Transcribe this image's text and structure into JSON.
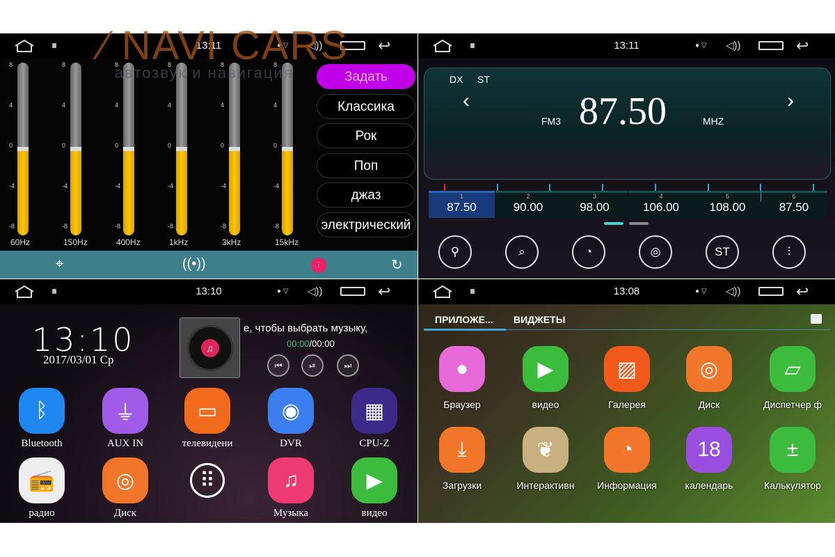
{
  "watermark": {
    "brand": "NAVI CARS",
    "tagline": "автозвук и навигация"
  },
  "equalizer": {
    "status_time": "13:11",
    "scale": [
      "8",
      "4",
      "0",
      "-4",
      "-8"
    ],
    "bands": [
      {
        "label": "60Hz",
        "value": 0
      },
      {
        "label": "150Hz",
        "value": 0
      },
      {
        "label": "400Hz",
        "value": 0
      },
      {
        "label": "1kHz",
        "value": 0
      },
      {
        "label": "3kHz",
        "value": 0
      },
      {
        "label": "15kHz",
        "value": 0
      }
    ],
    "range": [
      -8,
      8
    ],
    "presets": [
      "Задать",
      "Классика",
      "Рок",
      "Поп",
      "джаз",
      "электрический"
    ],
    "active_preset": "Задать",
    "bottom_icons": [
      "crosshair-icon",
      "surround-icon",
      "equalizer-icon",
      "reset-icon"
    ],
    "colors": {
      "fill": "#ffc400",
      "active": "#c000e8",
      "bar": "#3d7f8a"
    }
  },
  "radio": {
    "status_time": "13:11",
    "dx": "DX",
    "st": "ST",
    "band": "FM3",
    "frequency": "87.50",
    "unit": "MHZ",
    "presets": [
      {
        "n": "1",
        "f": "87.50"
      },
      {
        "n": "2",
        "f": "90.00"
      },
      {
        "n": "3",
        "f": "98.00"
      },
      {
        "n": "4",
        "f": "106.00"
      },
      {
        "n": "5",
        "f": "108.00"
      },
      {
        "n": "6",
        "f": "87.50"
      }
    ],
    "selected_preset": 1,
    "page": 1,
    "pages": 2,
    "buttons": [
      {
        "icon": "search-icon",
        "label": ""
      },
      {
        "icon": "scan-save-icon",
        "label": ""
      },
      {
        "icon": "signal-icon",
        "label": ""
      },
      {
        "icon": "local-distance-icon",
        "label": ""
      },
      {
        "icon": "stereo-icon",
        "label": "ST"
      },
      {
        "icon": "equalizer-icon",
        "label": ""
      }
    ]
  },
  "home": {
    "status_time": "13:10",
    "clock": "13:10",
    "date": "2017/03/01 Ср",
    "music_hint": "е, чтобы выбрать музыку,",
    "elapsed": "00:00",
    "total": "/00:00",
    "apps": [
      {
        "label": "Bluetooth",
        "icon": "bluetooth-icon",
        "color": "#1e88f0"
      },
      {
        "label": "AUX IN",
        "icon": "aux-icon",
        "color": "#a05be8"
      },
      {
        "label": "телевидени",
        "icon": "tv-icon",
        "color": "#f26a1b"
      },
      {
        "label": "DVR",
        "icon": "webcam-icon",
        "color": "#3a7ef0"
      },
      {
        "label": "CPU-Z",
        "icon": "cpu-icon",
        "color": "#3b2a8a"
      },
      {
        "label": "радио",
        "icon": "radio-icon",
        "color": "#eeeeee"
      },
      {
        "label": "Диск",
        "icon": "disc-icon",
        "color": "#f2762a"
      },
      {
        "label": "",
        "icon": "all-apps-icon",
        "color": "transparent"
      },
      {
        "label": "Музыка",
        "icon": "music-icon",
        "color": "#ee3b73"
      },
      {
        "label": "видео",
        "icon": "video-icon",
        "color": "#3cbc3c"
      }
    ]
  },
  "drawer": {
    "status_time": "13:08",
    "tabs": [
      "ПРИЛОЖЕ...",
      "ВИДЖЕТЫ"
    ],
    "apps": [
      {
        "label": "Браузер",
        "icon": "globe-icon",
        "color": "#e86ad8"
      },
      {
        "label": "видео",
        "icon": "video-icon",
        "color": "#3cbc3c"
      },
      {
        "label": "Галерея",
        "icon": "gallery-icon",
        "color": "#f25a1b"
      },
      {
        "label": "Диск",
        "icon": "disc-icon",
        "color": "#f2762a"
      },
      {
        "label": "Диспетчер ф",
        "icon": "folder-icon",
        "color": "#3cbc3c"
      },
      {
        "label": "Загрузки",
        "icon": "download-icon",
        "color": "#f2762a"
      },
      {
        "label": "Интерактивн",
        "icon": "live-wallpaper-icon",
        "color": "#c8b080"
      },
      {
        "label": "Информация",
        "icon": "info-icon",
        "color": "#f2762a"
      },
      {
        "label": "календарь",
        "icon": "calendar-icon",
        "color": "#9a4ee0"
      },
      {
        "label": "Калькулятор",
        "icon": "calculator-icon",
        "color": "#3cbc3c"
      }
    ]
  }
}
